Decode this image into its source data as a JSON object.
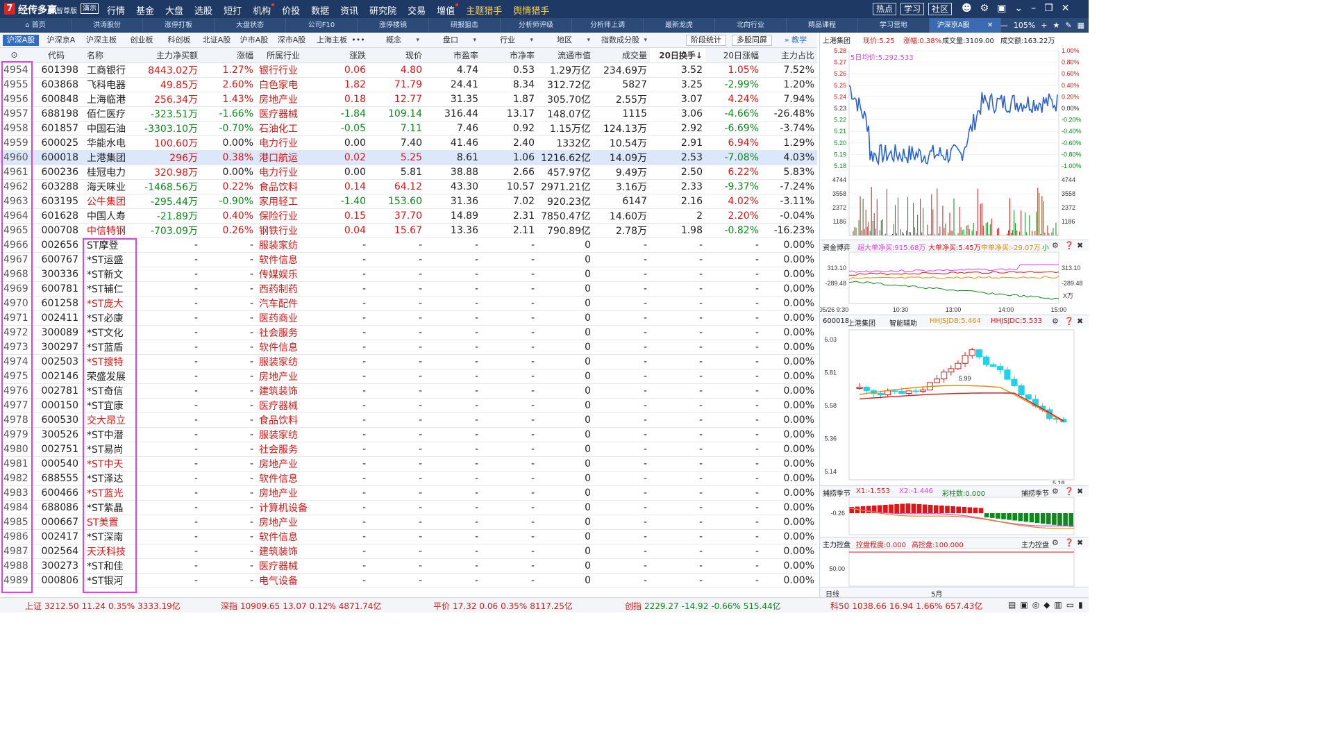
{
  "titlebar": {
    "brand": "经传多赢",
    "edition": "智尊版",
    "demo": "演示",
    "logo": "7",
    "menu": [
      {
        "label": "行情",
        "hl": false
      },
      {
        "label": "基金",
        "hl": false
      },
      {
        "label": "大盘",
        "hl": false
      },
      {
        "label": "选股",
        "hl": false
      },
      {
        "label": "短打",
        "hl": false
      },
      {
        "label": "机构",
        "hl": false,
        "dot": true
      },
      {
        "label": "价投",
        "hl": false
      },
      {
        "label": "数据",
        "hl": false
      },
      {
        "label": "资讯",
        "hl": false
      },
      {
        "label": "研究院",
        "hl": false
      },
      {
        "label": "交易",
        "hl": false
      },
      {
        "label": "增值",
        "hl": false,
        "dot": true
      },
      {
        "label": "主题猎手",
        "hl": true
      },
      {
        "label": "舆情猎手",
        "hl": true
      }
    ],
    "right_buttons": [
      "热点",
      "学习",
      "社区"
    ]
  },
  "navtabs": {
    "tabs": [
      "首页",
      "洪涛股份",
      "涨停打板",
      "大盘状态",
      "公司F10",
      "涨停楼镜",
      "研报狙击",
      "分析师评级",
      "分析师上调",
      "最新龙虎",
      "北向行业",
      "精品课程",
      "学习营地",
      "沪深京A股"
    ],
    "active": 13,
    "zoom": "105%"
  },
  "filterbar": {
    "tabs": [
      "沪深A股",
      "沪深京A",
      "沪深主板",
      "创业板",
      "科创板",
      "北证A股",
      "沪市A股",
      "深市A股",
      "上海主板"
    ],
    "more": "•••",
    "dropdowns": [
      "概念",
      "盘口",
      "行业",
      "地区",
      "指数成分股"
    ],
    "buttons": [
      "阶段统计",
      "多股同屏"
    ],
    "teach": "教学"
  },
  "table": {
    "headers": [
      "",
      "代码",
      "名称",
      "主力净买额",
      "涨幅",
      "所属行业",
      "涨跌",
      "现价",
      "市盈率",
      "市净率",
      "流通市值",
      "成交量",
      "20日换手↓",
      "20日涨幅",
      "主力占比"
    ],
    "selected_index": 6,
    "rows": [
      {
        "i": "4954",
        "code": "601398",
        "name": "工商银行",
        "nc": "fl",
        "net": "8443.02万",
        "pct": "1.27%",
        "ind": "银行行业",
        "chg": "0.06",
        "price": "4.80",
        "pe": "4.74",
        "pb": "0.53",
        "cap": "1.29万亿",
        "vol": "234.69万",
        "to": "3.52",
        "r20": "1.05%",
        "share": "7.52%",
        "dir": "up",
        "netdir": "up",
        "r20dir": "up",
        "sharedir": "fl"
      },
      {
        "i": "4955",
        "code": "603868",
        "name": "飞科电器",
        "nc": "fl",
        "net": "49.85万",
        "pct": "2.60%",
        "ind": "白色家电",
        "chg": "1.82",
        "price": "71.79",
        "pe": "24.41",
        "pb": "8.34",
        "cap": "312.72亿",
        "vol": "5827",
        "to": "3.25",
        "r20": "-2.99%",
        "share": "1.20%",
        "dir": "up",
        "netdir": "up",
        "r20dir": "dn",
        "sharedir": "fl"
      },
      {
        "i": "4956",
        "code": "600848",
        "name": "上海临港",
        "nc": "fl",
        "net": "256.34万",
        "pct": "1.43%",
        "ind": "房地产业",
        "chg": "0.18",
        "price": "12.77",
        "pe": "31.35",
        "pb": "1.87",
        "cap": "305.70亿",
        "vol": "2.55万",
        "to": "3.07",
        "r20": "4.24%",
        "share": "7.94%",
        "dir": "up",
        "netdir": "up",
        "r20dir": "up",
        "sharedir": "fl"
      },
      {
        "i": "4957",
        "code": "688198",
        "name": "佰仁医疗",
        "nc": "fl",
        "net": "-323.51万",
        "pct": "-1.66%",
        "ind": "医疗器械",
        "chg": "-1.84",
        "price": "109.14",
        "pe": "316.44",
        "pb": "13.17",
        "cap": "148.07亿",
        "vol": "1115",
        "to": "3.06",
        "r20": "-4.66%",
        "share": "-26.48%",
        "dir": "dn",
        "netdir": "dn",
        "r20dir": "dn",
        "sharedir": "fl"
      },
      {
        "i": "4958",
        "code": "601857",
        "name": "中国石油",
        "nc": "fl",
        "net": "-3303.10万",
        "pct": "-0.70%",
        "ind": "石油化工",
        "chg": "-0.05",
        "price": "7.11",
        "pe": "7.46",
        "pb": "0.92",
        "cap": "1.15万亿",
        "vol": "124.13万",
        "to": "2.92",
        "r20": "-6.69%",
        "share": "-3.74%",
        "dir": "dn",
        "netdir": "dn",
        "r20dir": "dn",
        "sharedir": "fl"
      },
      {
        "i": "4959",
        "code": "600025",
        "name": "华能水电",
        "nc": "fl",
        "net": "100.60万",
        "pct": "0.00%",
        "ind": "电力行业",
        "chg": "0.00",
        "price": "7.40",
        "pe": "41.46",
        "pb": "2.40",
        "cap": "1332亿",
        "vol": "10.54万",
        "to": "2.91",
        "r20": "6.94%",
        "share": "1.29%",
        "dir": "fl",
        "netdir": "up",
        "r20dir": "up",
        "sharedir": "fl"
      },
      {
        "i": "4960",
        "code": "600018",
        "name": "上港集团",
        "nc": "fl",
        "net": "296万",
        "pct": "0.38%",
        "ind": "港口航运",
        "chg": "0.02",
        "price": "5.25",
        "pe": "8.61",
        "pb": "1.06",
        "cap": "1216.62亿",
        "vol": "14.09万",
        "to": "2.53",
        "r20": "-7.08%",
        "share": "4.03%",
        "dir": "up",
        "netdir": "up",
        "r20dir": "dn",
        "sharedir": "fl"
      },
      {
        "i": "4961",
        "code": "600236",
        "name": "桂冠电力",
        "nc": "fl",
        "net": "320.98万",
        "pct": "0.00%",
        "ind": "电力行业",
        "chg": "0.00",
        "price": "5.81",
        "pe": "38.88",
        "pb": "2.66",
        "cap": "457.97亿",
        "vol": "9.49万",
        "to": "2.50",
        "r20": "6.22%",
        "share": "5.83%",
        "dir": "fl",
        "netdir": "up",
        "r20dir": "up",
        "sharedir": "fl"
      },
      {
        "i": "4962",
        "code": "603288",
        "name": "海天味业",
        "nc": "fl",
        "net": "-1468.56万",
        "pct": "0.22%",
        "ind": "食品饮料",
        "chg": "0.14",
        "price": "64.12",
        "pe": "43.30",
        "pb": "10.57",
        "cap": "2971.21亿",
        "vol": "3.16万",
        "to": "2.33",
        "r20": "-9.37%",
        "share": "-7.24%",
        "dir": "up",
        "netdir": "dn",
        "r20dir": "dn",
        "sharedir": "fl"
      },
      {
        "i": "4963",
        "code": "603195",
        "name": "公牛集团",
        "nc": "rd",
        "net": "-295.44万",
        "pct": "-0.90%",
        "ind": "家用轻工",
        "chg": "-1.40",
        "price": "153.60",
        "pe": "31.36",
        "pb": "7.02",
        "cap": "920.23亿",
        "vol": "6147",
        "to": "2.16",
        "r20": "4.02%",
        "share": "-3.11%",
        "dir": "dn",
        "netdir": "dn",
        "r20dir": "up",
        "sharedir": "fl"
      },
      {
        "i": "4964",
        "code": "601628",
        "name": "中国人寿",
        "nc": "fl",
        "net": "-21.89万",
        "pct": "0.40%",
        "ind": "保险行业",
        "chg": "0.15",
        "price": "37.70",
        "pe": "14.89",
        "pb": "2.31",
        "cap": "7850.47亿",
        "vol": "14.60万",
        "to": "2",
        "r20": "2.20%",
        "share": "-0.04%",
        "dir": "up",
        "netdir": "dn",
        "r20dir": "up",
        "sharedir": "fl"
      },
      {
        "i": "4965",
        "code": "000708",
        "name": "中信特钢",
        "nc": "rd",
        "net": "-703.09万",
        "pct": "0.26%",
        "ind": "钢铁行业",
        "chg": "0.04",
        "price": "15.67",
        "pe": "13.36",
        "pb": "2.11",
        "cap": "790.89亿",
        "vol": "2.78万",
        "to": "1.98",
        "r20": "-0.82%",
        "share": "-16.23%",
        "dir": "up",
        "netdir": "dn",
        "r20dir": "dn",
        "sharedir": "fl"
      },
      {
        "i": "4966",
        "code": "002656",
        "name": "ST摩登",
        "nc": "fl",
        "ind": "服装家纺"
      },
      {
        "i": "4967",
        "code": "600767",
        "name": "*ST运盛",
        "nc": "fl",
        "ind": "软件信息"
      },
      {
        "i": "4968",
        "code": "300336",
        "name": "*ST新文",
        "nc": "fl",
        "ind": "传媒娱乐"
      },
      {
        "i": "4969",
        "code": "600781",
        "name": "*ST辅仁",
        "nc": "fl",
        "ind": "西药制药"
      },
      {
        "i": "4970",
        "code": "601258",
        "name": "*ST庞大",
        "nc": "rd",
        "ind": "汽车配件"
      },
      {
        "i": "4971",
        "code": "002411",
        "name": "*ST必康",
        "nc": "fl",
        "ind": "医药商业"
      },
      {
        "i": "4972",
        "code": "300089",
        "name": "*ST文化",
        "nc": "fl",
        "ind": "社会服务"
      },
      {
        "i": "4973",
        "code": "300297",
        "name": "*ST蓝盾",
        "nc": "fl",
        "ind": "软件信息"
      },
      {
        "i": "4974",
        "code": "002503",
        "name": "*ST搜特",
        "nc": "rd",
        "ind": "服装家纺"
      },
      {
        "i": "4975",
        "code": "002146",
        "name": "荣盛发展",
        "nc": "fl",
        "ind": "房地产业"
      },
      {
        "i": "4976",
        "code": "002781",
        "name": "*ST奇信",
        "nc": "fl",
        "ind": "建筑装饰"
      },
      {
        "i": "4977",
        "code": "000150",
        "name": "*ST宜康",
        "nc": "fl",
        "ind": "医疗器械"
      },
      {
        "i": "4978",
        "code": "600530",
        "name": "交大昂立",
        "nc": "rd",
        "ind": "食品饮料"
      },
      {
        "i": "4979",
        "code": "300526",
        "name": "*ST中潜",
        "nc": "fl",
        "ind": "服装家纺"
      },
      {
        "i": "4980",
        "code": "002751",
        "name": "*ST易尚",
        "nc": "fl",
        "ind": "社会服务"
      },
      {
        "i": "4981",
        "code": "000540",
        "name": "*ST中天",
        "nc": "rd",
        "ind": "房地产业"
      },
      {
        "i": "4982",
        "code": "688555",
        "name": "*ST泽达",
        "nc": "fl",
        "ind": "软件信息"
      },
      {
        "i": "4983",
        "code": "600466",
        "name": "*ST蓝光",
        "nc": "rd",
        "ind": "房地产业"
      },
      {
        "i": "4984",
        "code": "688086",
        "name": "*ST紫晶",
        "nc": "fl",
        "ind": "计算机设备"
      },
      {
        "i": "4985",
        "code": "000667",
        "name": "ST美置",
        "nc": "rd",
        "ind": "房地产业"
      },
      {
        "i": "4986",
        "code": "002417",
        "name": "*ST深南",
        "nc": "fl",
        "ind": "软件信息"
      },
      {
        "i": "4987",
        "code": "002564",
        "name": "天沃科技",
        "nc": "rd",
        "ind": "建筑装饰"
      },
      {
        "i": "4988",
        "code": "300273",
        "name": "*ST和佳",
        "nc": "fl",
        "ind": "医疗器械"
      },
      {
        "i": "4989",
        "code": "000806",
        "name": "*ST银河",
        "nc": "fl",
        "ind": "电气设备"
      }
    ],
    "empty": {
      "dash": "-",
      "zero": "0",
      "pct": "0.00%"
    }
  },
  "statusbar": [
    {
      "name": "上证",
      "v": "3212.50",
      "c": "11.24",
      "p": "0.35%",
      "a": "3333.19亿"
    },
    {
      "name": "深指",
      "v": "10909.65",
      "c": "13.07",
      "p": "0.12%",
      "a": "4871.74亿"
    },
    {
      "name": "平价",
      "v": "17.32",
      "c": "0.06",
      "p": "0.35%",
      "a": "8117.25亿"
    },
    {
      "name": "创指",
      "v": "2229.27",
      "c": "-14.92",
      "p": "-0.66%",
      "a": "515.44亿"
    },
    {
      "name": "科50",
      "v": "1038.66",
      "c": "16.94",
      "p": "1.66%",
      "a": "657.43亿"
    }
  ],
  "rpanel": {
    "intraday": {
      "name": "上港集团",
      "price_label": "现价:5.25",
      "pct_label": "涨幅:0.38%",
      "vol_label": "成交量:3109.00",
      "amt_label": "成交额:163.22万",
      "avg_label": "5日均价:5.292.533",
      "yticks": [
        "5.28",
        "5.27",
        "5.26",
        "5.25",
        "5.24",
        "5.23",
        "5.22",
        "5.21",
        "5.20",
        "5.19",
        "5.18"
      ],
      "pticks": [
        "1.00%",
        "0.80%",
        "0.60%",
        "0.40%",
        "0.20%",
        "0.00%",
        "-0.20%",
        "-0.40%",
        "-0.60%",
        "-0.80%",
        "-1.00%"
      ],
      "volticks": [
        "4744",
        "3558",
        "2372",
        "1186"
      ]
    },
    "capflow": {
      "title": "资金博弈",
      "s1": "超大单净买:915.68万",
      "s2": "大单净买:5.45万",
      "s3": "中单净买:-29.07万",
      "s4": "小",
      "top": "313.10",
      "bot": "-289.48",
      "unit": "X万",
      "xticks": [
        "05/26 9:30",
        "10:30",
        "13:00",
        "14:00",
        "15:00"
      ]
    },
    "kline": {
      "code": "600018",
      "name": "上港集团",
      "assist": "智能辅助",
      "l1": "HHJSJDB:5.464",
      "l2": "HHJSJDC:5.533",
      "yticks": [
        "6.03",
        "5.81",
        "5.58",
        "5.36",
        "5.14"
      ],
      "hi": "5.99",
      "lo": "5.18"
    },
    "season": {
      "title": "捕捞季节",
      "x1": "X1:-1.553",
      "x2": "X2:-1.446",
      "col": "彩柱数:0.000",
      "title_r": "捕捞季节",
      "tick": "-0.26"
    },
    "control": {
      "title": "主力控盘",
      "deg": "控盘程度:0.000",
      "hi": "高控盘:100.000",
      "title_r": "主力控盘",
      "tick": "50.00"
    },
    "bottom": {
      "left": "日线",
      "month": "5月"
    }
  }
}
